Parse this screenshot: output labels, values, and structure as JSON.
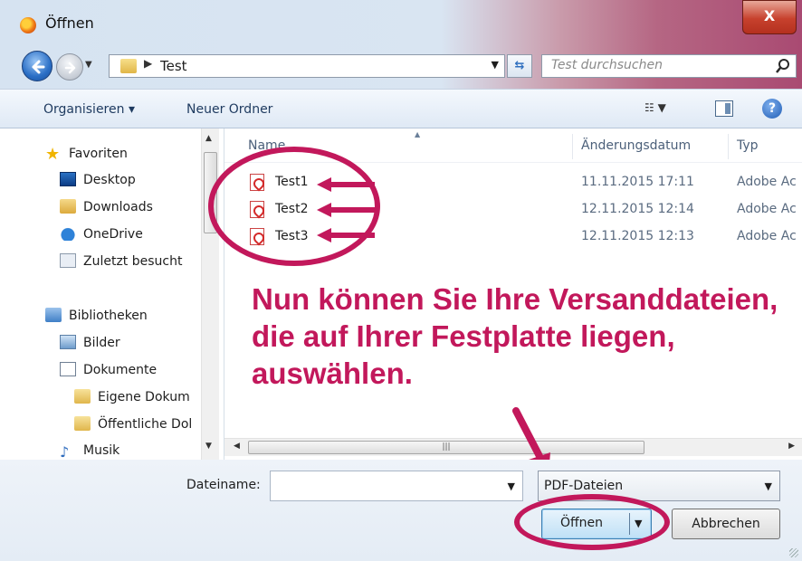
{
  "window": {
    "title": "Öffnen",
    "close_label": "X"
  },
  "address": {
    "path": "Test",
    "search_placeholder": "Test durchsuchen"
  },
  "toolbar": {
    "organize_label": "Organisieren ▾",
    "new_folder_label": "Neuer Ordner",
    "help_label": "?"
  },
  "nav": {
    "favorites_header": "Favoriten",
    "favorites": [
      "Desktop",
      "Downloads",
      "OneDrive",
      "Zuletzt besucht"
    ],
    "libraries_header": "Bibliotheken",
    "libraries": [
      "Bilder",
      "Dokumente",
      "Eigene Dokum",
      "Öffentliche Dol",
      "Musik"
    ]
  },
  "columns": {
    "name": "Name",
    "date": "Änderungsdatum",
    "type": "Typ"
  },
  "files": [
    {
      "name": "Test1",
      "date": "11.11.2015 17:11",
      "type": "Adobe Ac"
    },
    {
      "name": "Test2",
      "date": "12.11.2015 12:14",
      "type": "Adobe Ac"
    },
    {
      "name": "Test3",
      "date": "12.11.2015 12:13",
      "type": "Adobe Ac"
    }
  ],
  "annotation": {
    "text": "Nun können Sie Ihre Versanddateien, die auf Ihrer Festplatte liegen, auswählen.",
    "color": "#c2185b"
  },
  "footer": {
    "filename_label": "Dateiname:",
    "filename_value": "",
    "filetype_value": "PDF-Dateien",
    "open_label": "Öffnen",
    "cancel_label": "Abbrechen"
  }
}
